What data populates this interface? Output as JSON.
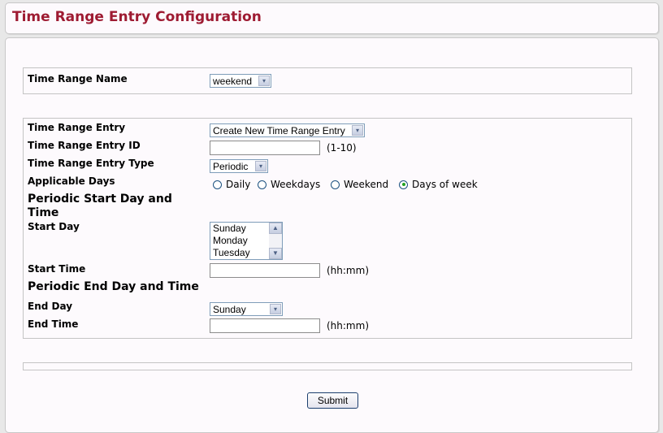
{
  "header": {
    "title": "Time Range Entry Configuration"
  },
  "time_range_name": {
    "label": "Time Range Name",
    "value": "weekend"
  },
  "entry": {
    "entry_label": "Time Range Entry",
    "entry_value": "Create New Time Range Entry",
    "id_label": "Time Range Entry ID",
    "id_value": "",
    "id_hint": "(1-10)",
    "type_label": "Time Range Entry Type",
    "type_value": "Periodic",
    "days_label": "Applicable Days",
    "days_options": [
      {
        "label": "Daily",
        "checked": false
      },
      {
        "label": "Weekdays",
        "checked": false
      },
      {
        "label": "Weekend",
        "checked": false
      },
      {
        "label": "Days of week",
        "checked": true
      }
    ],
    "start_header": "Periodic Start Day and Time",
    "start_day_label": "Start Day",
    "start_day_options": [
      "Sunday",
      "Monday",
      "Tuesday"
    ],
    "start_time_label": "Start Time",
    "start_time_value": "",
    "start_time_hint": "(hh:mm)",
    "end_header": "Periodic End Day and Time",
    "end_day_label": "End Day",
    "end_day_value": "Sunday",
    "end_time_label": "End Time",
    "end_time_value": "",
    "end_time_hint": "(hh:mm)"
  },
  "actions": {
    "submit_label": "Submit"
  },
  "icons": {
    "dropdown_arrow": "▾",
    "scroll_up": "▲",
    "scroll_down": "▼"
  }
}
